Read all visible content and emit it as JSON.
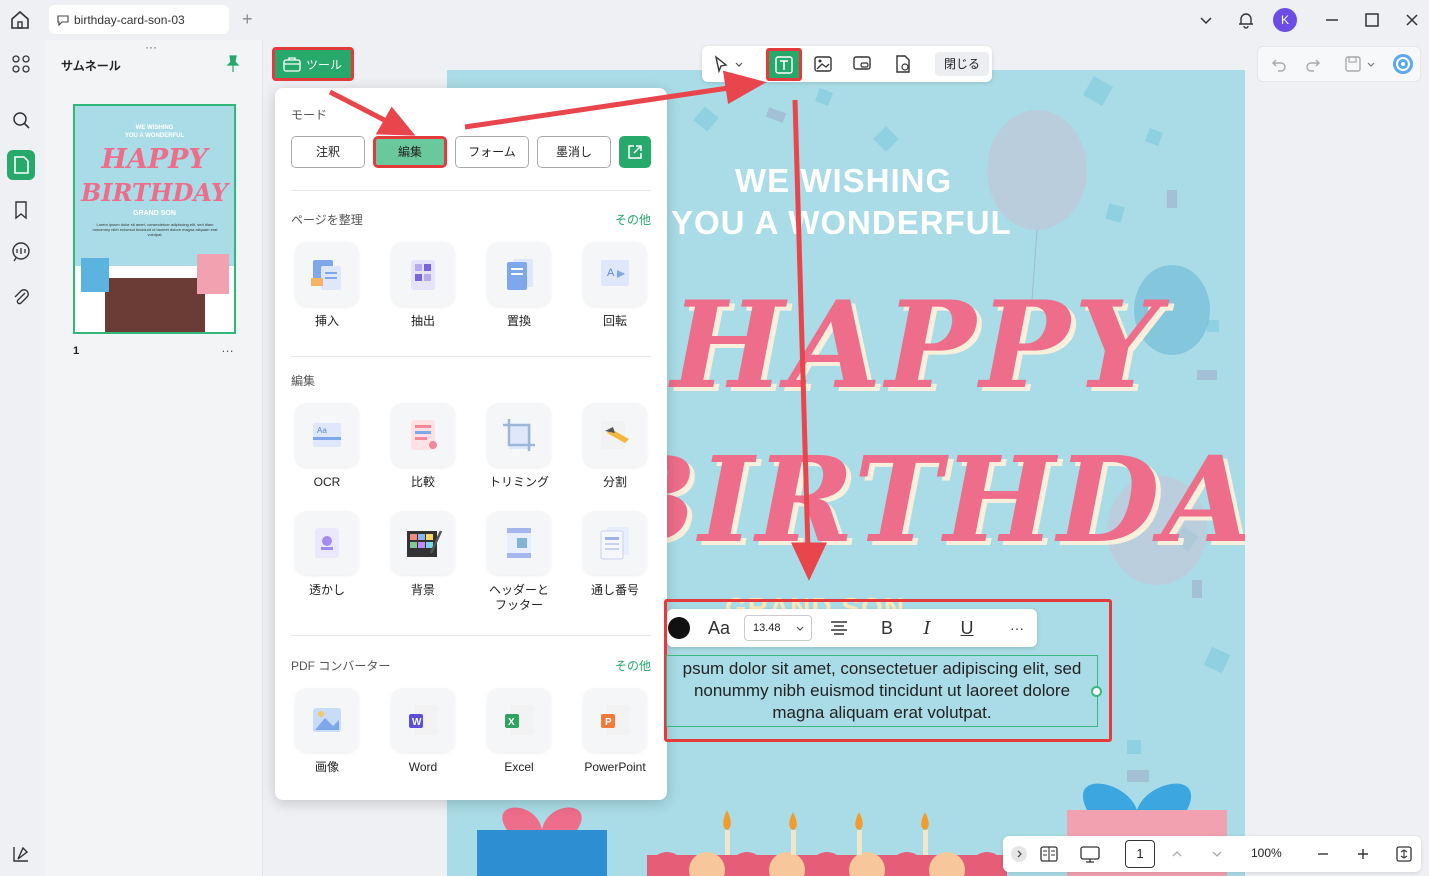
{
  "titlebar": {
    "tab_title": "birthday-card-son-03",
    "avatar_letter": "K"
  },
  "thumbnail_panel": {
    "title": "サムネール",
    "page_number": "1",
    "more": "…"
  },
  "tools_button": {
    "label": "ツール"
  },
  "top_toolbar": {
    "close_label": "閉じる"
  },
  "popup": {
    "mode_label": "モード",
    "modes": [
      "注釈",
      "編集",
      "フォーム",
      "墨消し"
    ],
    "active_mode": "編集",
    "organize": {
      "label": "ページを整理",
      "more": "その他",
      "tools": [
        "挿入",
        "抽出",
        "置換",
        "回転"
      ]
    },
    "edit": {
      "label": "編集",
      "tools": [
        "OCR",
        "比較",
        "トリミング",
        "分割",
        "透かし",
        "背景",
        "ヘッダーと\nフッター",
        "通し番号"
      ]
    },
    "converter": {
      "label": "PDF コンバーター",
      "more": "その他",
      "tools": [
        "画像",
        "Word",
        "Excel",
        "PowerPoint"
      ]
    }
  },
  "card": {
    "line1": "WE WISHING",
    "line2": "YOU A WONDERFUL",
    "happy": "HAPPY",
    "birthday": "BIRTHDAY",
    "grand_son": "GRAND SON",
    "thumb_small": "WE WISHING\nYOU A WONDERFUL",
    "thumb_happy": "HAPPY",
    "thumb_birthday": "BIRTHDAY",
    "thumb_grandson": "GRAND SON",
    "thumb_lorem": "Lorem ipsum dolor sit amet, consectetuer adipiscing elit, sed diam nonummy nibh euismod tincidunt ut laoreet dolore magna aliquam erat volutpat."
  },
  "format_bar": {
    "font_label": "Aa",
    "font_size": "13.48",
    "bold": "B",
    "italic": "I",
    "underline": "U",
    "more": "···"
  },
  "edited_text": {
    "line1": "psum dolor sit amet, consectetuer adipiscing elit, sed",
    "line2": "nonummy nibh euismod tincidunt ut laoreet dolore",
    "line3": "magna aliquam erat volutpat."
  },
  "bottom_bar": {
    "page": "1",
    "zoom": "100%"
  },
  "colors": {
    "accent": "#27a96c",
    "highlight": "#e33b3b",
    "card_bg": "#a9dce6",
    "happy_pink": "#ee6d8a"
  }
}
